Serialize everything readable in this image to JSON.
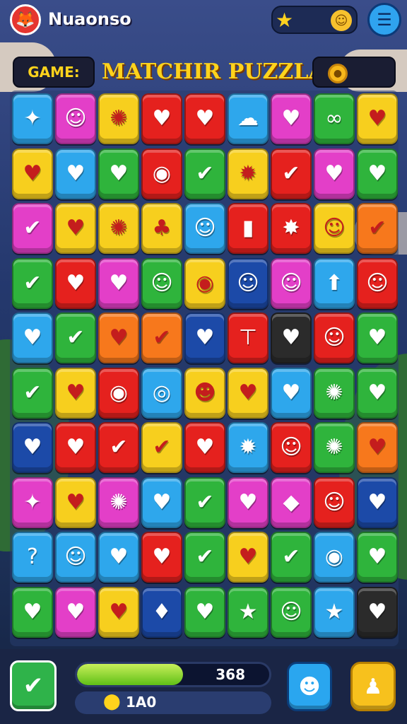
{
  "app": {
    "name": "Nuaonso",
    "logo_icon": "fox-icon"
  },
  "header": {
    "tag_label": "GAME:",
    "title": "MATCHIR PUZZLA!",
    "star_icon": "★",
    "face_icon": "☺",
    "menu_icon": "☰",
    "coin_icon": "●"
  },
  "footer": {
    "score": "368",
    "progress_fraction": 0.55,
    "moves": "1A0",
    "check_icon": "✔",
    "pin_icon": "⬤",
    "chat_icon": "☻",
    "user_icon": "♟"
  },
  "colors": {
    "B": "#2ea7ec",
    "P": "#e33fc8",
    "Y": "#f7cf1e",
    "R": "#e5211e",
    "G": "#2fb43c",
    "O": "#f7781c",
    "N": "#1c4aa8",
    "K": "#2b2b2b"
  },
  "board": {
    "rows": [
      [
        {
          "c": "B",
          "i": "✦"
        },
        {
          "c": "P",
          "i": "☺"
        },
        {
          "c": "Y",
          "i": "✺"
        },
        {
          "c": "R",
          "i": "♥"
        },
        {
          "c": "R",
          "i": "♥"
        },
        {
          "c": "B",
          "i": "☁"
        },
        {
          "c": "P",
          "i": "♥"
        },
        {
          "c": "G",
          "i": "∞"
        },
        {
          "c": "Y",
          "i": "♥"
        }
      ],
      [
        {
          "c": "Y",
          "i": "♥"
        },
        {
          "c": "B",
          "i": "♥"
        },
        {
          "c": "G",
          "i": "♥"
        },
        {
          "c": "R",
          "i": "◉"
        },
        {
          "c": "G",
          "i": "✔"
        },
        {
          "c": "Y",
          "i": "✹"
        },
        {
          "c": "R",
          "i": "✔"
        },
        {
          "c": "P",
          "i": "♥"
        },
        {
          "c": "G",
          "i": "♥"
        }
      ],
      [
        {
          "c": "P",
          "i": "✔"
        },
        {
          "c": "Y",
          "i": "♥"
        },
        {
          "c": "Y",
          "i": "✺"
        },
        {
          "c": "Y",
          "i": "♣"
        },
        {
          "c": "B",
          "i": "☺"
        },
        {
          "c": "R",
          "i": "▮"
        },
        {
          "c": "R",
          "i": "✸"
        },
        {
          "c": "Y",
          "i": "☺"
        },
        {
          "c": "O",
          "i": "✔"
        }
      ],
      [
        {
          "c": "G",
          "i": "✔"
        },
        {
          "c": "R",
          "i": "♥"
        },
        {
          "c": "P",
          "i": "♥"
        },
        {
          "c": "G",
          "i": "☺"
        },
        {
          "c": "Y",
          "i": "◉"
        },
        {
          "c": "N",
          "i": "☺"
        },
        {
          "c": "P",
          "i": "☺"
        },
        {
          "c": "B",
          "i": "⬆"
        },
        {
          "c": "R",
          "i": "☺"
        }
      ],
      [
        {
          "c": "B",
          "i": "♥"
        },
        {
          "c": "G",
          "i": "✔"
        },
        {
          "c": "O",
          "i": "♥"
        },
        {
          "c": "O",
          "i": "✔"
        },
        {
          "c": "N",
          "i": "♥"
        },
        {
          "c": "R",
          "i": "⊤"
        },
        {
          "c": "K",
          "i": "♥"
        },
        {
          "c": "R",
          "i": "☺"
        },
        {
          "c": "G",
          "i": "♥"
        }
      ],
      [
        {
          "c": "G",
          "i": "✔"
        },
        {
          "c": "Y",
          "i": "♥"
        },
        {
          "c": "R",
          "i": "◉"
        },
        {
          "c": "B",
          "i": "◎"
        },
        {
          "c": "Y",
          "i": "☻"
        },
        {
          "c": "Y",
          "i": "♥"
        },
        {
          "c": "B",
          "i": "♥"
        },
        {
          "c": "G",
          "i": "✺"
        },
        {
          "c": "G",
          "i": "♥"
        }
      ],
      [
        {
          "c": "N",
          "i": "♥"
        },
        {
          "c": "R",
          "i": "♥"
        },
        {
          "c": "R",
          "i": "✔"
        },
        {
          "c": "Y",
          "i": "✔"
        },
        {
          "c": "R",
          "i": "♥"
        },
        {
          "c": "B",
          "i": "✹"
        },
        {
          "c": "R",
          "i": "☺"
        },
        {
          "c": "G",
          "i": "✺"
        },
        {
          "c": "O",
          "i": "♥"
        }
      ],
      [
        {
          "c": "P",
          "i": "✦"
        },
        {
          "c": "Y",
          "i": "♥"
        },
        {
          "c": "P",
          "i": "✺"
        },
        {
          "c": "B",
          "i": "♥"
        },
        {
          "c": "G",
          "i": "✔"
        },
        {
          "c": "P",
          "i": "♥"
        },
        {
          "c": "P",
          "i": "◆"
        },
        {
          "c": "R",
          "i": "☺"
        },
        {
          "c": "N",
          "i": "♥"
        }
      ],
      [
        {
          "c": "B",
          "i": "?"
        },
        {
          "c": "B",
          "i": "☺"
        },
        {
          "c": "B",
          "i": "♥"
        },
        {
          "c": "R",
          "i": "♥"
        },
        {
          "c": "G",
          "i": "✔"
        },
        {
          "c": "Y",
          "i": "♥"
        },
        {
          "c": "G",
          "i": "✔"
        },
        {
          "c": "B",
          "i": "◉"
        },
        {
          "c": "G",
          "i": "♥"
        }
      ],
      [
        {
          "c": "G",
          "i": "♥"
        },
        {
          "c": "P",
          "i": "♥"
        },
        {
          "c": "Y",
          "i": "♥"
        },
        {
          "c": "N",
          "i": "♦"
        },
        {
          "c": "G",
          "i": "♥"
        },
        {
          "c": "G",
          "i": "★"
        },
        {
          "c": "G",
          "i": "☺"
        },
        {
          "c": "B",
          "i": "★"
        },
        {
          "c": "K",
          "i": "♥"
        }
      ]
    ]
  }
}
